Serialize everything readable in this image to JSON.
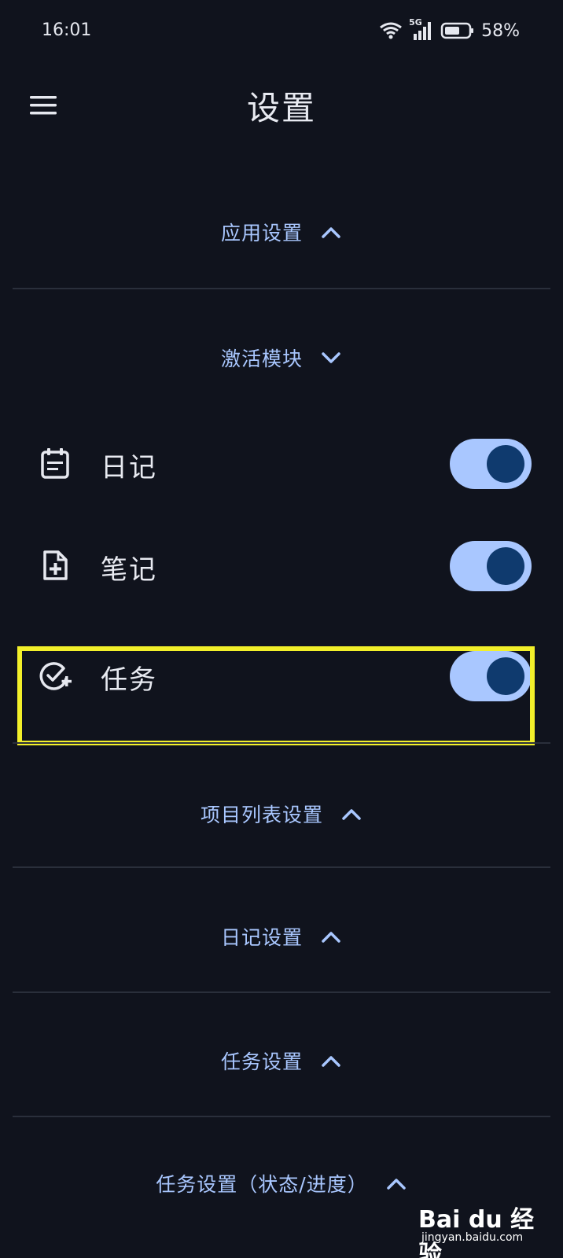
{
  "status_bar": {
    "time": "16:01",
    "network_label": "5G",
    "battery": "58%"
  },
  "app_bar": {
    "title": "设置",
    "menu_icon": "hamburger-menu-icon"
  },
  "sections": {
    "app_settings": "应用设置",
    "activate_modules": "激活模块",
    "project_list_settings": "项目列表设置",
    "diary_settings": "日记设置",
    "task_settings": "任务设置",
    "task_status_settings": "任务设置（状态/进度）"
  },
  "modules": [
    {
      "label": "日记",
      "icon": "diary-calendar-icon",
      "enabled": true
    },
    {
      "label": "笔记",
      "icon": "note-add-icon",
      "enabled": true
    },
    {
      "label": "任务",
      "icon": "task-check-add-icon",
      "enabled": true
    }
  ],
  "colors": {
    "background": "#10131d",
    "accent": "#a9c7ff",
    "toggle_knob": "#0f3a6e",
    "highlight": "#f2ef2a",
    "divider": "#2a2f3b"
  },
  "watermark": {
    "brand": "Bai du 经验",
    "url": "jingyan.baidu.com"
  }
}
